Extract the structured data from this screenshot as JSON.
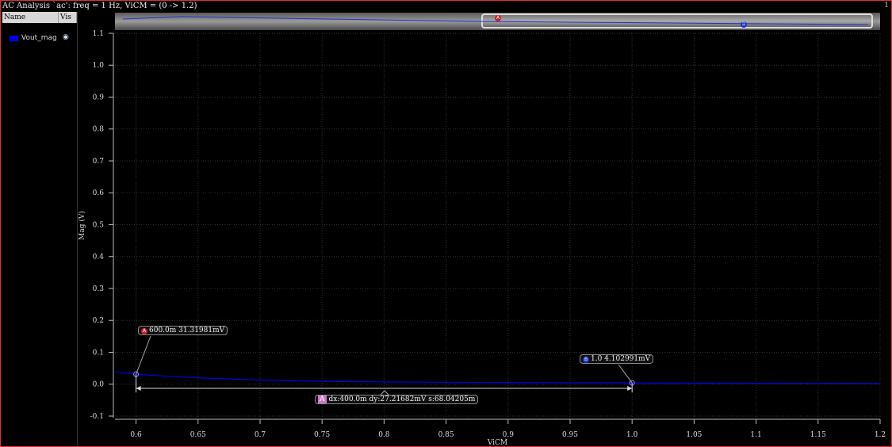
{
  "window": {
    "title": "AC Analysis `ac': freq = 1 Hz, ViCM = (0 -> 1.2)",
    "number": "1"
  },
  "legend": {
    "headers": [
      "Name",
      "Vis"
    ],
    "traces": [
      {
        "name": "Vout_mag",
        "color": "#0000ee",
        "visible": true,
        "icon": "eye-icon"
      }
    ]
  },
  "markers": {
    "A": {
      "label": "600.0m 31.31981mV",
      "color": "#cc2222"
    },
    "B": {
      "label": "1.0 4.102991mV",
      "color": "#2233cc"
    },
    "delta": {
      "label": "dx:400.0m dy:27.21682mV s:68.04205m",
      "badge": "A",
      "color": "#cc77cc"
    }
  },
  "chart_data": {
    "type": "line",
    "xlabel": "ViCM",
    "ylabel": "Mag (V)",
    "xlim": [
      0.583,
      1.2
    ],
    "ylim": [
      -0.105,
      1.1
    ],
    "xticks": [
      "0.6",
      "0.65",
      "0.7",
      "0.75",
      "0.8",
      "0.85",
      "0.9",
      "0.95",
      "1.0",
      "1.05",
      "1.1",
      "1.15",
      "1.2"
    ],
    "yticks": [
      "-0.1",
      "0.0",
      "0.1",
      "0.2",
      "0.3",
      "0.4",
      "0.5",
      "0.6",
      "0.7",
      "0.8",
      "0.9",
      "1.0",
      "1.1"
    ],
    "grid": true,
    "series": [
      {
        "name": "Vout_mag",
        "color": "#0000ee",
        "x": [
          0.583,
          0.6,
          0.625,
          0.65,
          0.7,
          0.75,
          0.8,
          0.85,
          0.9,
          0.95,
          1.0,
          1.1,
          1.2
        ],
        "y": [
          0.039,
          0.0313,
          0.025,
          0.02,
          0.013,
          0.009,
          0.007,
          0.006,
          0.005,
          0.0045,
          0.0041,
          0.003,
          0.0025
        ]
      }
    ],
    "markers": [
      {
        "name": "A",
        "x": 0.6,
        "y": 0.03132
      },
      {
        "name": "B",
        "x": 1.0,
        "y": 0.004103
      }
    ]
  }
}
